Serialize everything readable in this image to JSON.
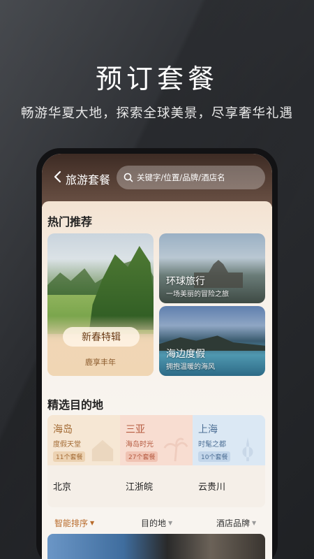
{
  "promo": {
    "title": "预订套餐",
    "subtitle": "畅游华夏大地，探索全球美景，尽享奢华礼遇"
  },
  "header": {
    "title": "旅游套餐",
    "search_placeholder": "关键字/位置/品牌/酒店名"
  },
  "hot": {
    "title": "热门推荐",
    "feature": {
      "pill": "新春特辑",
      "sub": "鹿享丰年"
    },
    "card1": {
      "title": "环球旅行",
      "desc": "一场美丽的冒险之旅"
    },
    "card2": {
      "title": "海边度假",
      "desc": "拥抱温暖的海风"
    }
  },
  "destinations": {
    "title": "精选目的地",
    "top": [
      {
        "name": "海岛",
        "desc": "度假天堂",
        "badge": "11个套餐",
        "bg": "#f6e7d4",
        "color": "#a36a33",
        "badgeBg": "#ecd2b2"
      },
      {
        "name": "三亚",
        "desc": "海岛时光",
        "badge": "27个套餐",
        "bg": "#f8ddd1",
        "color": "#b55a40",
        "badgeBg": "#f0c3b3"
      },
      {
        "name": "上海",
        "desc": "时髦之都",
        "badge": "10个套餐",
        "bg": "#dbe8f4",
        "color": "#4d6f95",
        "badgeBg": "#c3d6ea"
      }
    ],
    "bottom": [
      "北京",
      "江浙皖",
      "云贵川"
    ]
  },
  "filters": {
    "sort": "智能排序",
    "destination": "目的地",
    "brand": "酒店品牌"
  },
  "colors": {
    "accent": "#b86a2a"
  }
}
